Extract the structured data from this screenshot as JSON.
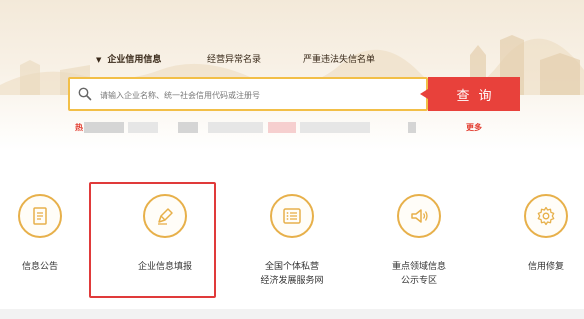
{
  "tabs": [
    {
      "label": "企业信用信息",
      "active": true
    },
    {
      "label": "经营异常名录",
      "active": false
    },
    {
      "label": "严重违法失信名单",
      "active": false
    }
  ],
  "tab_caret": "▼",
  "search": {
    "placeholder": "请输入企业名称、统一社会信用代码或注册号",
    "button_label": "查询"
  },
  "hot": {
    "label": "热",
    "more": "更多"
  },
  "services": [
    {
      "label": "信息公告",
      "icon": "document-icon"
    },
    {
      "label": "企业信息填报",
      "icon": "pen-icon"
    },
    {
      "label": "全国个体私营\n经济发展服务网",
      "icon": "list-icon"
    },
    {
      "label": "重点领域信息\n公示专区",
      "icon": "megaphone-icon"
    },
    {
      "label": "信用修复",
      "icon": "gear-icon"
    }
  ],
  "colors": {
    "accent_red": "#e8413b",
    "icon_gold": "#e7b04a",
    "search_border": "#f2bf47",
    "highlight_red": "#e03a3a"
  }
}
